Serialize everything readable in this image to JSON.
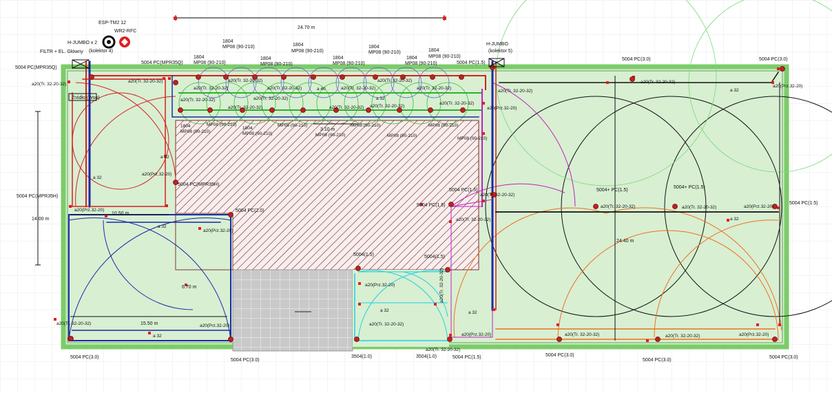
{
  "dimensions": {
    "top_width": "24.70 m",
    "left_height": "14.00 m",
    "right_height": "24.40 m",
    "left_zone_a": "10.50 m",
    "left_zone_b": "6.70 m",
    "left_zone_c": "15.50 m",
    "center_small": "3.10 m"
  },
  "equipment": {
    "esp_controller": "ESP-TM2 12",
    "sensor": "WR2-RFC",
    "filter": "FILTR + EL. Główny",
    "hjumbo_left": "H-JUMBO x 2",
    "collector_left": "(kolektor 4)",
    "hjumbo_right": "H-JUMBO",
    "collector_right": "(kolektor 5)",
    "source": "Źródło (Woo)"
  },
  "labels": {
    "pc_3": "5004 PC(3.0)",
    "pc_15": "5004 PC(1.5)",
    "pc_20": "5004 PC(2.0)",
    "pc_mpr35q": "5004 PC(MPR35Q)",
    "pc_mpr35h": "5004 PC(MPR35H)",
    "pc_plus_15": "5004+ PC(1.5)",
    "pc_1504": "3504(1.0)",
    "nozzle_1804": "1804",
    "mp08": "MP08 (90-210)",
    "pipe_tr": "a20(Tr. 32-20-32)",
    "pipe_prz": "a20(Prz.32-20)",
    "pipe_a32": "a 32",
    "pipe_a40": "a 40",
    "pc_1504_top": "5004(1.5)",
    "pc_tr": "5004 PC(1.5)"
  }
}
